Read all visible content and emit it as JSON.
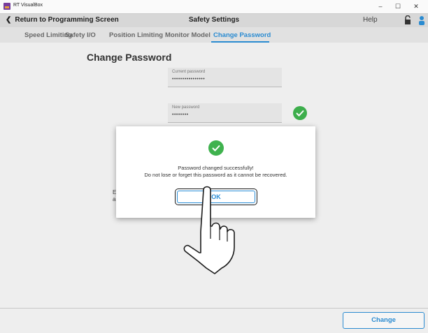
{
  "window": {
    "app_title": "RT VisualBox",
    "minimize": "–",
    "maximize": "☐",
    "close": "✕"
  },
  "header": {
    "back_label": "Return to Programming Screen",
    "title": "Safety Settings",
    "help_label": "Help"
  },
  "tabs": [
    {
      "label": "Speed Limiting",
      "active": false
    },
    {
      "label": "Safety I/O",
      "active": false
    },
    {
      "label": "Position Limiting",
      "active": false
    },
    {
      "label": "Monitor Model",
      "active": false
    },
    {
      "label": "Change Password",
      "active": true
    }
  ],
  "page": {
    "heading": "Change Password",
    "current_password": {
      "label": "Current password",
      "value": "••••••••••••••••"
    },
    "new_password": {
      "label": "New password",
      "value": "••••••••"
    },
    "obscured_text_1": "E",
    "obscured_text_2": "a"
  },
  "footer": {
    "change_label": "Change"
  },
  "dialog": {
    "message_line1": "Password changed successfully!",
    "message_line2": "Do not lose or forget this password as it cannot be recovered.",
    "ok_label": "OK"
  },
  "colors": {
    "accent": "#2b8ed6",
    "success": "#3fb24e"
  }
}
